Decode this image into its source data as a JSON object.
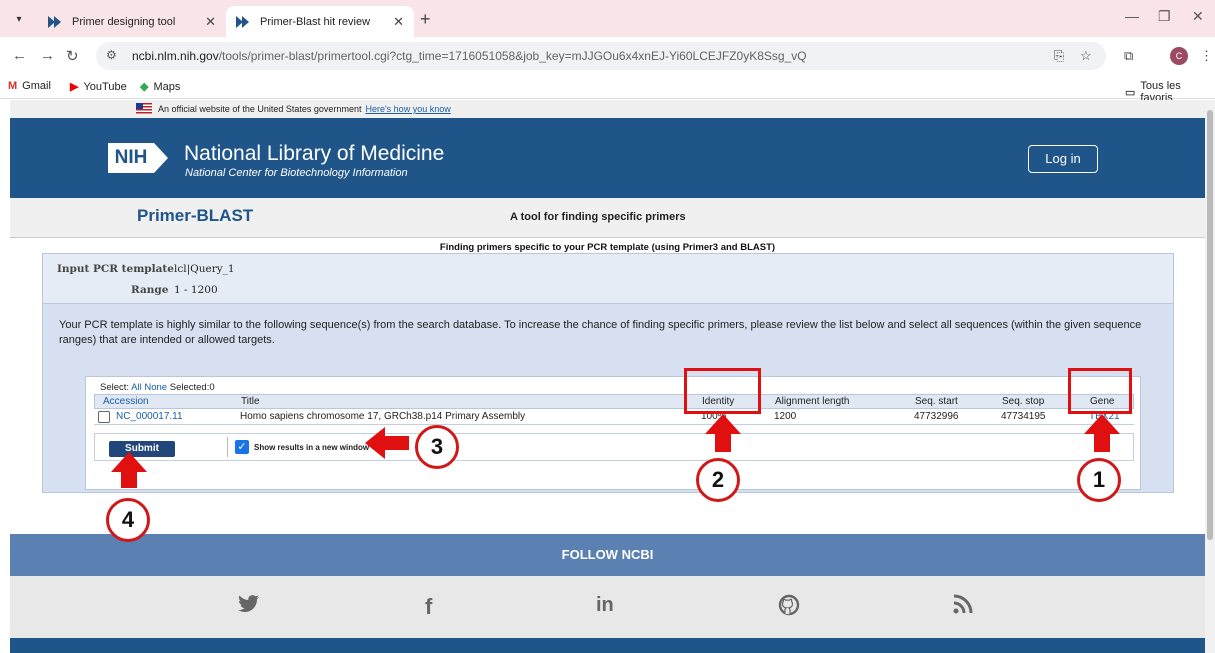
{
  "browser": {
    "tabs": [
      {
        "title": "Primer designing tool",
        "active": false
      },
      {
        "title": "Primer-Blast hit review",
        "active": true
      }
    ],
    "url_host": "ncbi.nlm.nih.gov",
    "url_path": "/tools/primer-blast/primertool.cgi?ctg_time=1716051058&job_key=mJJGOu6x4xnEJ-Yi60LCEJFZ0yK8Ssg_vQ",
    "profile_initial": "C",
    "bookmarks": [
      "Gmail",
      "YouTube",
      "Maps"
    ],
    "all_bookmarks": "Tous les favoris"
  },
  "gov_banner": {
    "text": "An official website of the United States government",
    "link": "Here's how you know"
  },
  "header": {
    "logo": "NIH",
    "title": "National Library of Medicine",
    "subtitle": "National Center for Biotechnology Information",
    "login": "Log in"
  },
  "primer_blast": {
    "title": "Primer-BLAST",
    "tagline": "A tool for finding specific primers",
    "section_title": "Finding primers specific to your PCR template (using Primer3 and BLAST)"
  },
  "template": {
    "input_label": "Input PCR template",
    "input_value": "lcl|Query_1",
    "range_label": "Range",
    "range_value": "1 - 1200"
  },
  "instructions": "Your PCR template is highly similar to the following sequence(s) from the search database. To increase the chance of finding specific primers, please review the list below and select all sequences (within the given sequence ranges) that are intended or allowed targets.",
  "selection": {
    "select_label": "Select:",
    "all": "All",
    "none": "None",
    "selected": "Selected:0"
  },
  "table": {
    "headers": [
      "Accession",
      "Title",
      "Identity",
      "Alignment length",
      "Seq. start",
      "Seq. stop",
      "Gene"
    ],
    "rows": [
      {
        "accession": "NC_000017.11",
        "title": "Homo sapiens chromosome 17, GRCh38.p14 Primary Assembly",
        "identity": "100%",
        "alignment_length": "1200",
        "seq_start": "47732996",
        "seq_stop": "47734195",
        "gene": "TBX21"
      }
    ]
  },
  "actions": {
    "submit": "Submit",
    "new_window_label": "Show results in a new window",
    "new_window_checked": true
  },
  "footer": {
    "follow": "FOLLOW NCBI"
  },
  "annotations": [
    "1",
    "2",
    "3",
    "4"
  ],
  "colors": {
    "ncbi_blue": "#20558a",
    "annotation_red": "#e01010",
    "panel_blue": "#d6e0f0"
  }
}
